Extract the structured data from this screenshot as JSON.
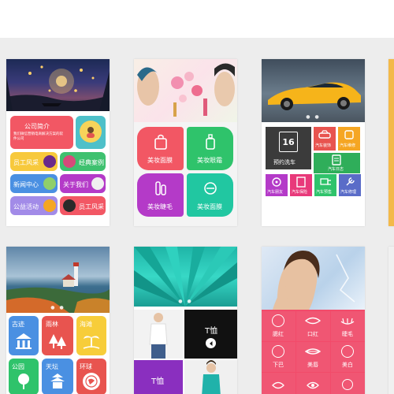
{
  "card1": {
    "company": "公司简介",
    "company_desc": "我们微信营销电商解决方案的软件公司",
    "staff": "员工风采",
    "cases": "经典案例",
    "news": "新闻中心",
    "about": "关于我们",
    "charity": "公益活动",
    "staff2": "员工风采"
  },
  "card2": {
    "tile1": "美妆面膜",
    "tile2": "美妆眼霜",
    "tile3": "美妆睫毛",
    "tile4": "美妆面膜"
  },
  "card3": {
    "calendar_num": "16",
    "carwash": "预约洗车",
    "decor": "汽车装饰",
    "maintain": "汽车维修",
    "diary": "汽车日志",
    "friends": "汽车朋友",
    "insurance": "汽车保险",
    "booking": "汽车预售",
    "repair": "汽车修理"
  },
  "card4": {
    "t1": "古迹",
    "t2": "雨林",
    "t3": "海滩",
    "t4": "公园",
    "t5": "天坛",
    "t6": "环球"
  },
  "card5": {
    "tshirt1": "T恤",
    "tshirt2": "T恤"
  },
  "card6": {
    "c1": "腮红",
    "c2": "口红",
    "c3": "睫毛",
    "c4": "下巴",
    "c5": "美唇",
    "c6": "美白"
  },
  "colors": {
    "pink_red": "#f25764",
    "green": "#2fc36b",
    "purple": "#b43ac8",
    "teal": "#21c7a1",
    "blue": "#4a90e2",
    "yellow": "#f7cd3a",
    "red": "#e8544f",
    "dark": "#3b3b3b"
  }
}
